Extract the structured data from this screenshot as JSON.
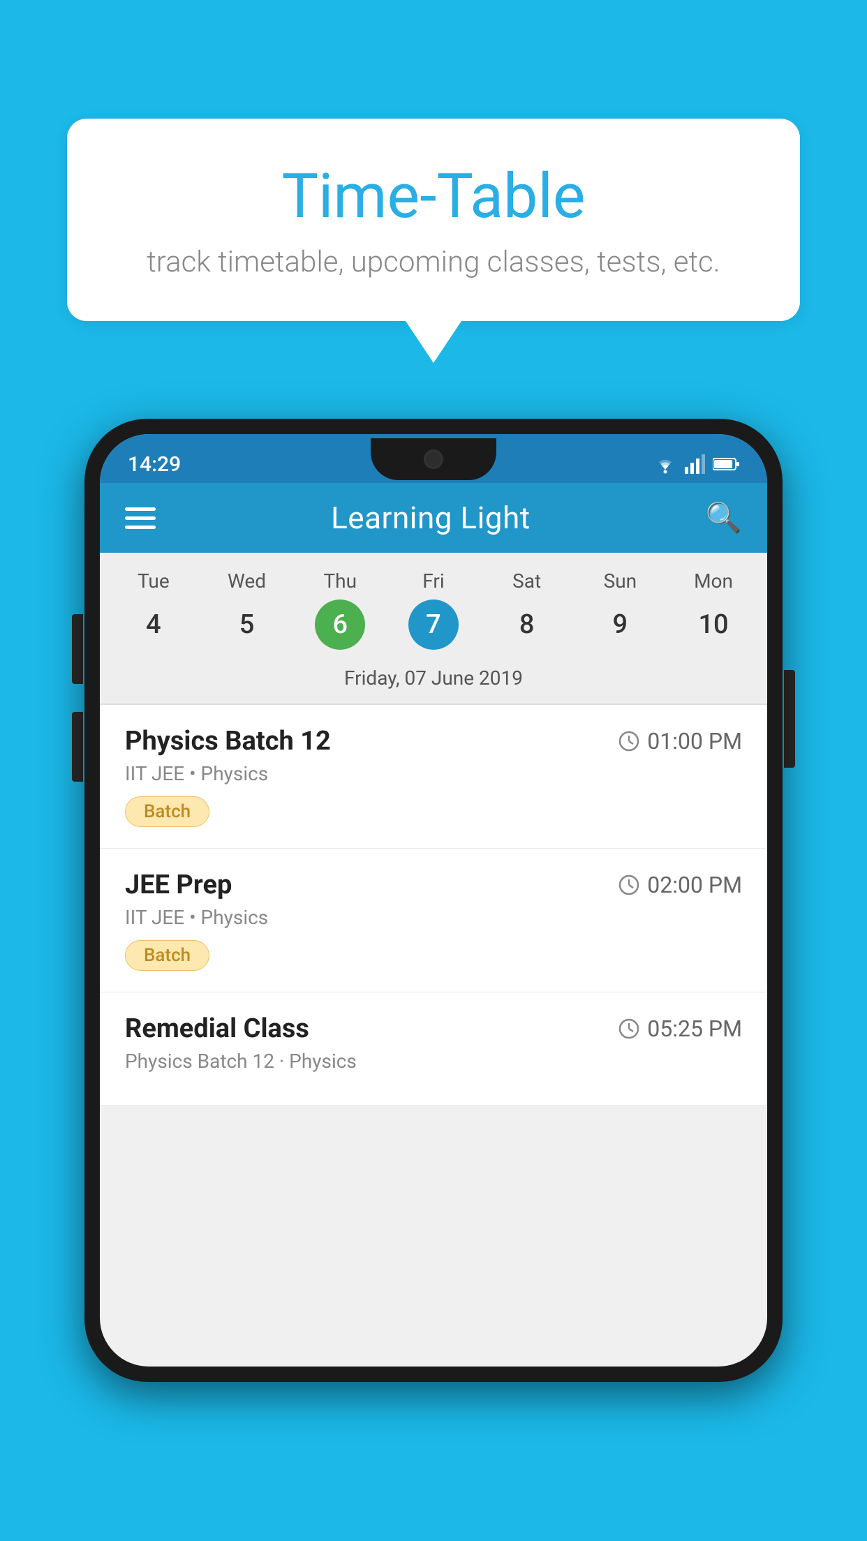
{
  "background_color": "#1bb8e8",
  "speech_bubble": {
    "title": "Time-Table",
    "subtitle": "track timetable, upcoming classes, tests, etc."
  },
  "phone": {
    "status_bar": {
      "time": "14:29"
    },
    "app_bar": {
      "title": "Learning Light"
    },
    "calendar": {
      "days": [
        {
          "name": "Tue",
          "num": "4",
          "state": "normal"
        },
        {
          "name": "Wed",
          "num": "5",
          "state": "normal"
        },
        {
          "name": "Thu",
          "num": "6",
          "state": "today"
        },
        {
          "name": "Fri",
          "num": "7",
          "state": "selected"
        },
        {
          "name": "Sat",
          "num": "8",
          "state": "normal"
        },
        {
          "name": "Sun",
          "num": "9",
          "state": "normal"
        },
        {
          "name": "Mon",
          "num": "10",
          "state": "normal"
        }
      ],
      "selected_date_label": "Friday, 07 June 2019"
    },
    "schedule": [
      {
        "title": "Physics Batch 12",
        "time": "01:00 PM",
        "sub": "IIT JEE • Physics",
        "badge": "Batch"
      },
      {
        "title": "JEE Prep",
        "time": "02:00 PM",
        "sub": "IIT JEE • Physics",
        "badge": "Batch"
      },
      {
        "title": "Remedial Class",
        "time": "05:25 PM",
        "sub": "Physics Batch 12 · Physics",
        "badge": ""
      }
    ]
  }
}
